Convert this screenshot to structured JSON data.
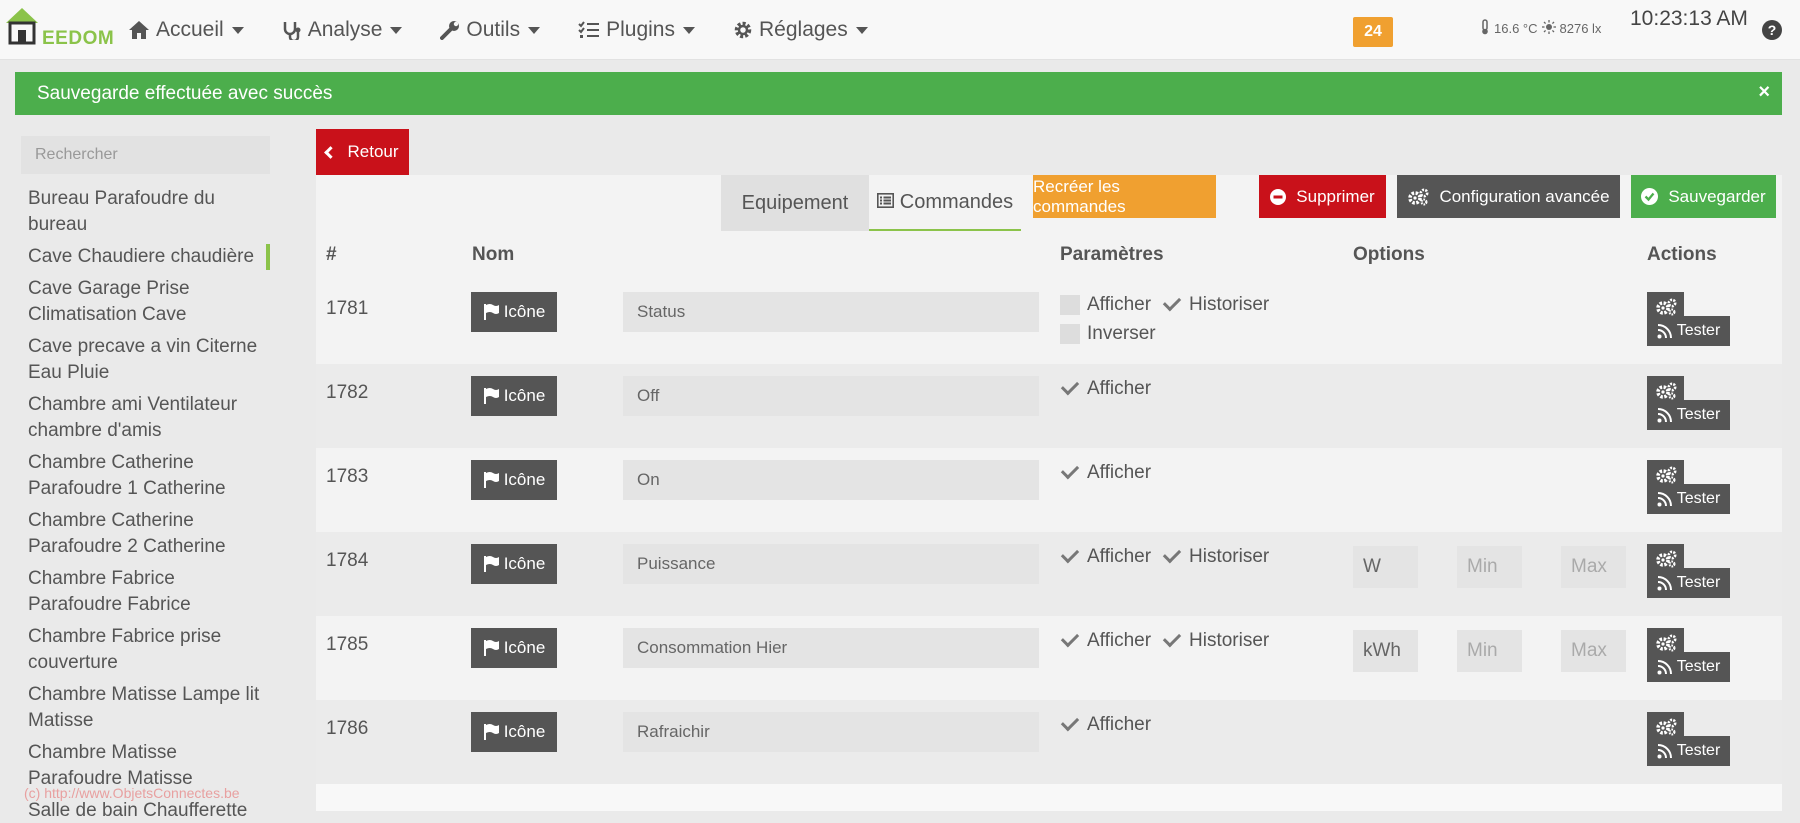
{
  "app": {
    "brand": "EEDOM"
  },
  "nav": {
    "items": [
      {
        "label": "Accueil",
        "icon": "home-icon"
      },
      {
        "label": "Analyse",
        "icon": "stethoscope-icon"
      },
      {
        "label": "Outils",
        "icon": "wrench-icon"
      },
      {
        "label": "Plugins",
        "icon": "tasks-icon"
      },
      {
        "label": "Réglages",
        "icon": "cog-icon"
      }
    ],
    "badge": "24",
    "temperature": "16.6 °C",
    "luminosity": "8276 lx",
    "clock": "10:23:13 AM",
    "help": "?"
  },
  "alert": {
    "message": "Sauvegarde effectuée avec succès",
    "close": "×"
  },
  "sidebar": {
    "search_placeholder": "Rechercher",
    "items": [
      {
        "label": "Bureau Parafoudre du bureau"
      },
      {
        "label": "Cave Chaudiere chaudière",
        "active": true
      },
      {
        "label": "Cave Garage Prise Climatisation Cave"
      },
      {
        "label": "Cave precave a vin Citerne Eau Pluie"
      },
      {
        "label": "Chambre ami Ventilateur chambre d'amis"
      },
      {
        "label": "Chambre Catherine Parafoudre 1 Catherine"
      },
      {
        "label": "Chambre Catherine Parafoudre 2 Catherine"
      },
      {
        "label": "Chambre Fabrice Parafoudre Fabrice"
      },
      {
        "label": "Chambre Fabrice prise couverture"
      },
      {
        "label": "Chambre Matisse Lampe lit Matisse"
      },
      {
        "label": "Chambre Matisse Parafoudre Matisse"
      },
      {
        "label": "Salle de bain Chaufferette"
      }
    ],
    "watermark": "(c) http://www.ObjetsConnectes.be"
  },
  "toolbar": {
    "retour": "Retour",
    "tab_equipement": "Equipement",
    "tab_commandes": "Commandes",
    "recreer": "Recréer les commandes",
    "supprimer": "Supprimer",
    "config": "Configuration avancée",
    "sauvegarder": "Sauvegarder"
  },
  "colors": {
    "accent": "#8bc34a",
    "success": "#4cae4c",
    "danger": "#c9111a",
    "warning": "#f0a030",
    "dark": "#555555"
  },
  "table": {
    "headers": {
      "id": "#",
      "nom": "Nom",
      "parametres": "Paramètres",
      "options": "Options",
      "actions": "Actions"
    },
    "labels": {
      "icone": "Icône",
      "afficher": "Afficher",
      "historiser": "Historiser",
      "inverser": "Inverser",
      "tester": "Tester",
      "min": "Min",
      "max": "Max"
    },
    "rows": [
      {
        "id": "1781",
        "name": "Status",
        "afficher": false,
        "historiser": true,
        "inverser": false
      },
      {
        "id": "1782",
        "name": "Off",
        "afficher": true
      },
      {
        "id": "1783",
        "name": "On",
        "afficher": true
      },
      {
        "id": "1784",
        "name": "Puissance",
        "afficher": true,
        "historiser": true,
        "unit": "W"
      },
      {
        "id": "1785",
        "name": "Consommation Hier",
        "afficher": true,
        "historiser": true,
        "unit": "kWh"
      },
      {
        "id": "1786",
        "name": "Rafraichir",
        "afficher": true
      }
    ]
  }
}
